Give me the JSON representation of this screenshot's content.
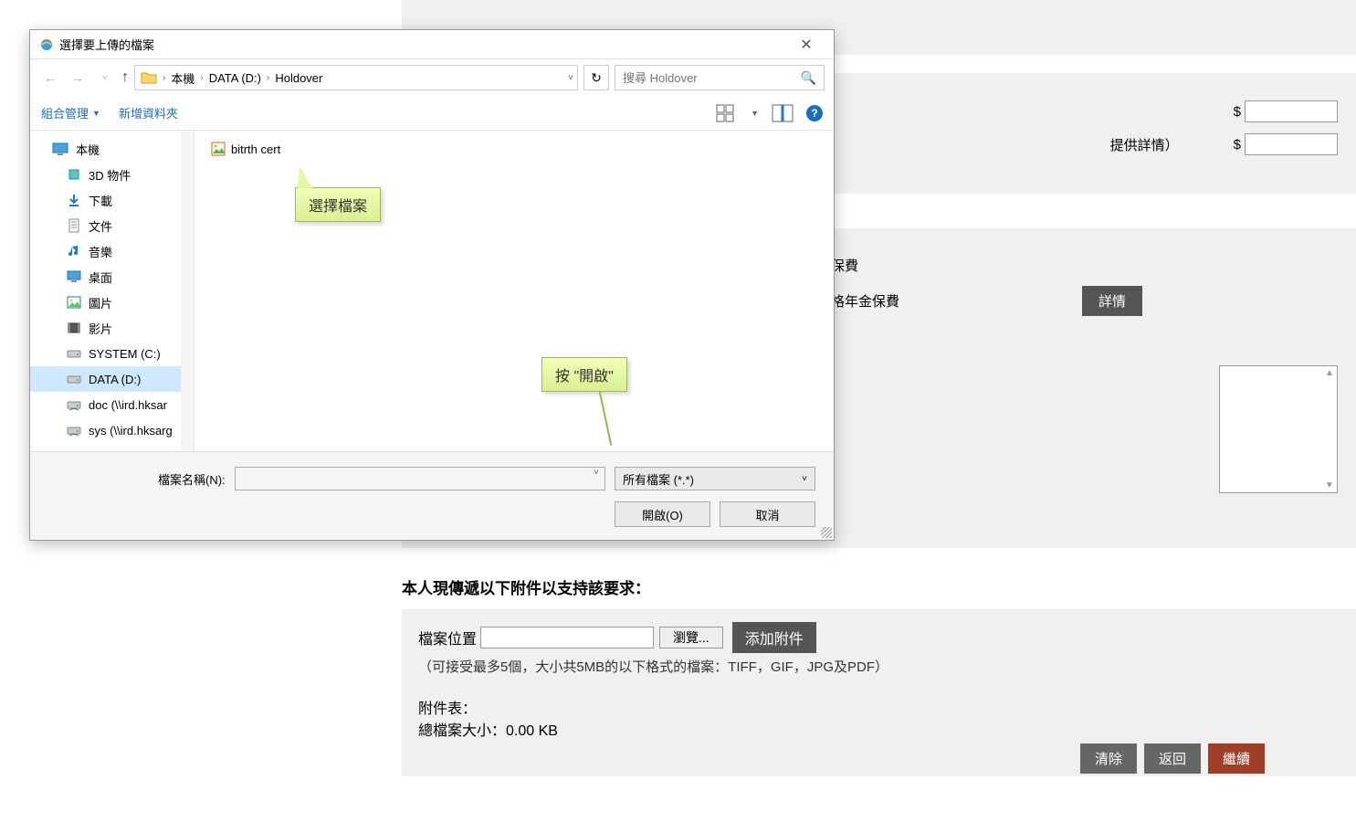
{
  "bg": {
    "row1_label": "提供詳情）",
    "dollar": "$",
    "row_ins1": "保費",
    "row_ins2": "格年金保費",
    "details_btn": "詳情"
  },
  "upload": {
    "title": "本人現傳遞以下附件以支持該要求：",
    "file_loc_label": "檔案位置",
    "browse": "瀏覽...",
    "add_attach": "添加附件",
    "hint": "（可接受最多5個，大小共5MB的以下格式的檔案：TIFF，GIF，JPG及PDF）",
    "attach_list_label": "附件表：",
    "total_size": "總檔案大小：0.00 KB"
  },
  "footer": {
    "clear": "清除",
    "back": "返回",
    "continue": "繼續"
  },
  "dialog": {
    "title": "選擇要上傳的檔案",
    "breadcrumb": [
      "本機",
      "DATA (D:)",
      "Holdover"
    ],
    "search_placeholder": "搜尋 Holdover",
    "organize": "組合管理",
    "new_folder": "新增資料夾",
    "tree": {
      "root": "本機",
      "items": [
        {
          "label": "3D 物件",
          "icon": "cube"
        },
        {
          "label": "下載",
          "icon": "download"
        },
        {
          "label": "文件",
          "icon": "document"
        },
        {
          "label": "音樂",
          "icon": "music"
        },
        {
          "label": "桌面",
          "icon": "desktop"
        },
        {
          "label": "圖片",
          "icon": "picture"
        },
        {
          "label": "影片",
          "icon": "video"
        },
        {
          "label": "SYSTEM (C:)",
          "icon": "drive"
        },
        {
          "label": "DATA (D:)",
          "icon": "drive",
          "selected": true
        },
        {
          "label": "doc (\\\\ird.hksar",
          "icon": "netdrive"
        },
        {
          "label": "sys (\\\\ird.hksarg",
          "icon": "netdrive"
        }
      ]
    },
    "files": [
      {
        "name": "bitrth cert",
        "icon": "image"
      }
    ],
    "callout1": "選擇檔案",
    "callout2": "按 \"開啟\"",
    "filename_label": "檔案名稱(N):",
    "filter": "所有檔案 (*.*)",
    "open_btn": "開啟(O)",
    "cancel_btn": "取消"
  }
}
